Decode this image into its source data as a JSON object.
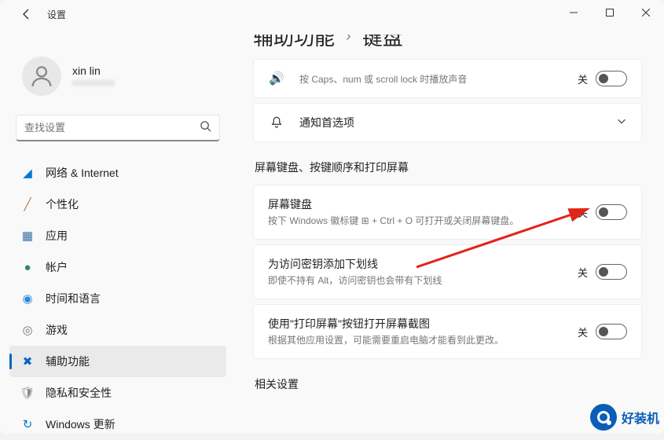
{
  "app_title": "设置",
  "user": {
    "name": "xin lin",
    "email": "xxxxxxxxx"
  },
  "search": {
    "placeholder": "查找设置"
  },
  "sidebar": {
    "items": [
      {
        "label": "网络 & Internet",
        "icon": "🌐"
      },
      {
        "label": "个性化",
        "icon": "✏️"
      },
      {
        "label": "应用",
        "icon": "🔲"
      },
      {
        "label": "帐户",
        "icon": "👤"
      },
      {
        "label": "时间和语言",
        "icon": "🌍"
      },
      {
        "label": "游戏",
        "icon": "🎮"
      },
      {
        "label": "辅助功能",
        "icon": "✖"
      },
      {
        "label": "隐私和安全性",
        "icon": "🛡"
      },
      {
        "label": "Windows 更新",
        "icon": "🔄"
      }
    ]
  },
  "breadcrumb": {
    "parent": "辅助功能",
    "current": "键盘"
  },
  "top_card_desc": "按 Caps、num 或 scroll lock 时播放声音",
  "notif_pref": "通知首选项",
  "section1": "屏幕键盘、按键顺序和打印屏幕",
  "cards": [
    {
      "title": "屏幕键盘",
      "desc": "按下 Windows 徽标键 ⊞ + Ctrl + O 可打开或关闭屏幕键盘。",
      "state": "关"
    },
    {
      "title": "为访问密钥添加下划线",
      "desc": "即使不持有 Alt，访问密钥也会带有下划线",
      "state": "关"
    },
    {
      "title": "使用\"打印屏幕\"按钮打开屏幕截图",
      "desc": "根据其他应用设置，可能需要重启电脑才能看到此更改。",
      "state": "关"
    }
  ],
  "section2": "相关设置",
  "watermark": "好装机"
}
